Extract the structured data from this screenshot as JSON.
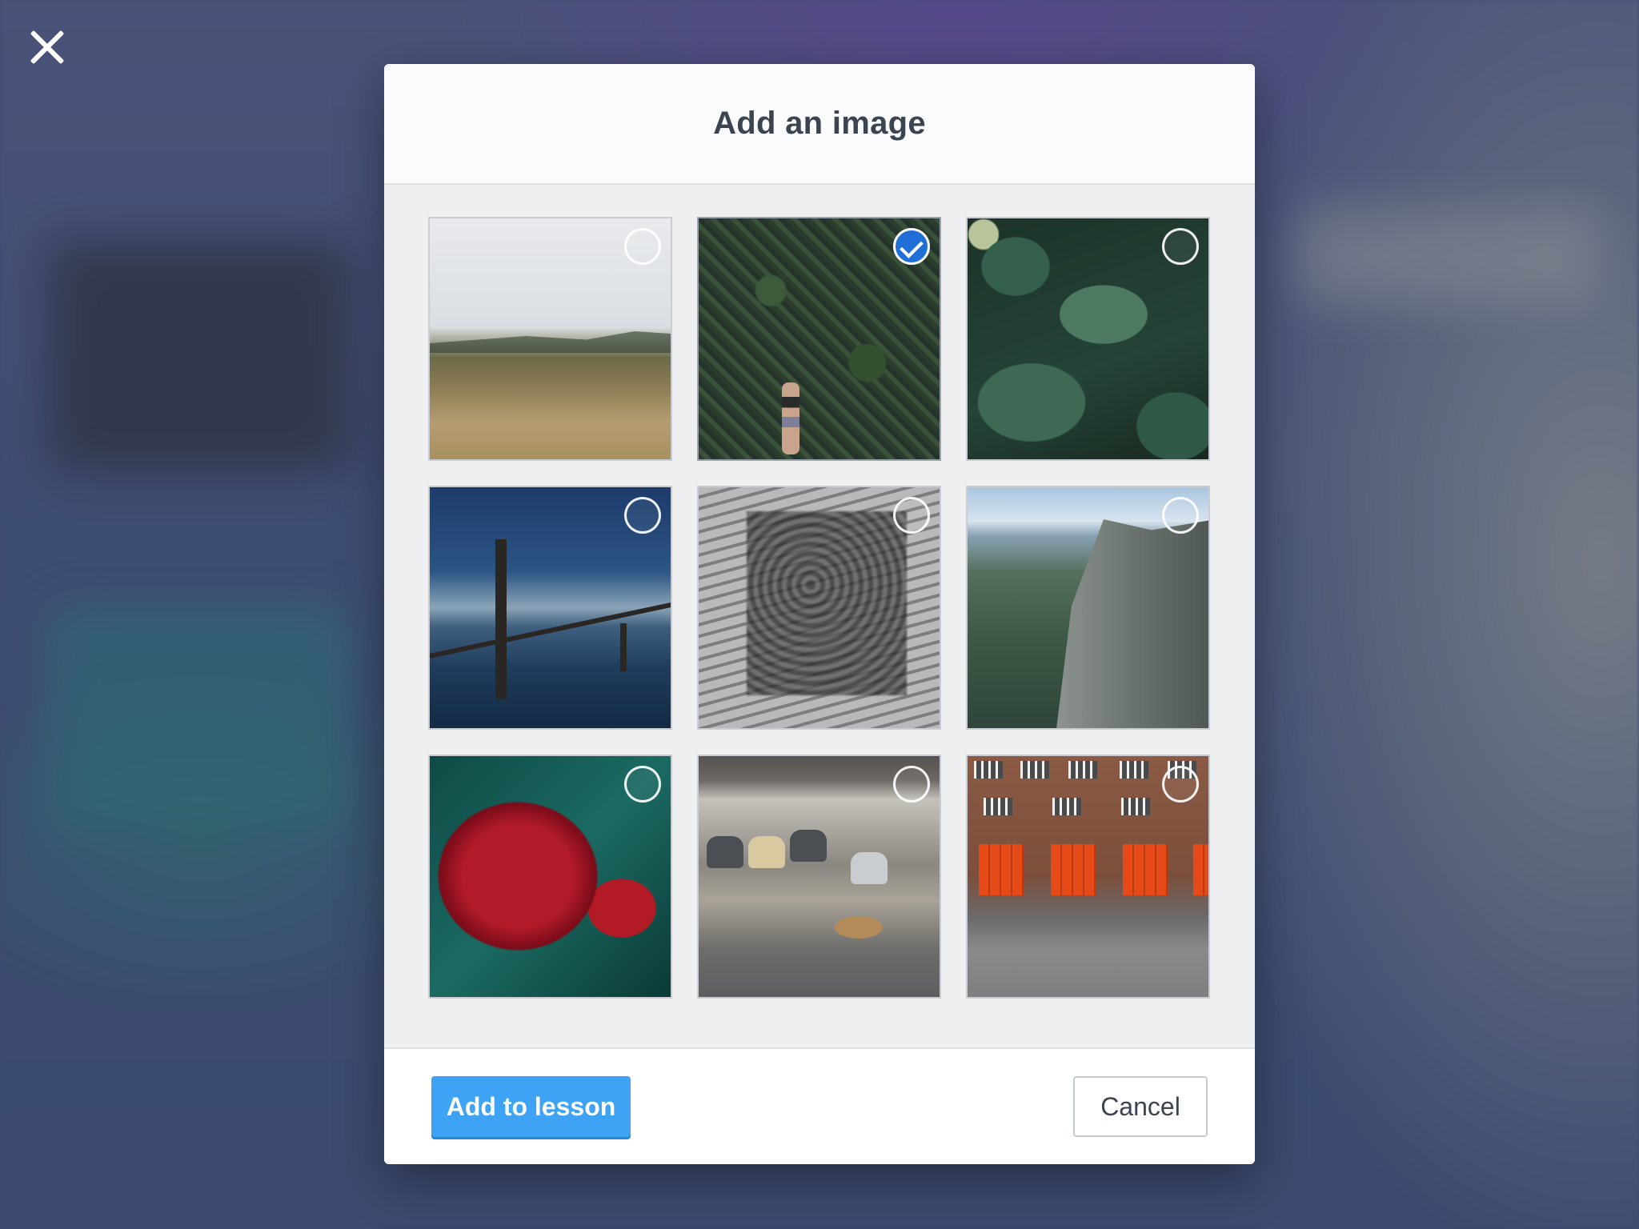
{
  "dialog": {
    "title": "Add an image"
  },
  "images": [
    {
      "name": "grassland-hills-photo",
      "selected": false
    },
    {
      "name": "ivy-wall-woman-photo",
      "selected": true
    },
    {
      "name": "green-leaves-photo",
      "selected": false
    },
    {
      "name": "golden-gate-bridge-photo",
      "selected": false
    },
    {
      "name": "crowd-stairs-photo",
      "selected": false
    },
    {
      "name": "yosemite-cliff-photo",
      "selected": false
    },
    {
      "name": "red-flower-photo",
      "selected": false
    },
    {
      "name": "office-lounge-chairs-photo",
      "selected": false
    },
    {
      "name": "fire-station-photo",
      "selected": false
    }
  ],
  "footer": {
    "primary_label": "Add to lesson",
    "cancel_label": "Cancel"
  },
  "colors": {
    "primary": "#3ea2f5",
    "check": "#1f6fd6"
  },
  "icons": {
    "close": "close-icon",
    "check": "checkmark-icon"
  }
}
